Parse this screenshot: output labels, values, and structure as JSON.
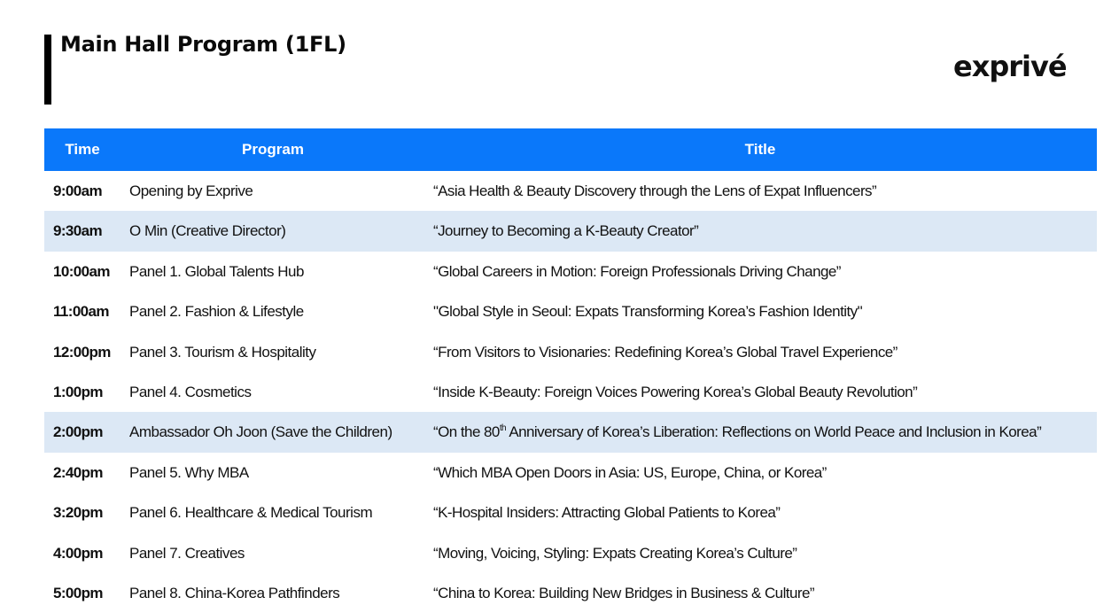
{
  "page": {
    "title": "Main Hall Program (1FL)",
    "logo_text": "exprivé"
  },
  "colors": {
    "header_bg": "#0a78fa",
    "highlight_row_bg": "#dce8f5",
    "title_bar": "#000000"
  },
  "table": {
    "headers": {
      "time": "Time",
      "program": "Program",
      "title": "Title"
    },
    "rows": [
      {
        "time": "9:00am",
        "program": "Opening by Exprive",
        "title": "“Asia Health & Beauty Discovery through the Lens of Expat Influencers”",
        "highlighted": false
      },
      {
        "time": "9:30am",
        "program": "O Min (Creative Director)",
        "title": "“Journey to Becoming a K-Beauty Creator”",
        "highlighted": true
      },
      {
        "time": "10:00am",
        "program": "Panel 1. Global Talents Hub",
        "title": "“Global Careers in Motion: Foreign Professionals Driving Change”",
        "highlighted": false
      },
      {
        "time": "11:00am",
        "program": "Panel 2. Fashion & Lifestyle",
        "title": "\"Global Style in Seoul: Expats Transforming Korea’s Fashion Identity\"",
        "highlighted": false
      },
      {
        "time": "12:00pm",
        "program": "Panel 3. Tourism & Hospitality",
        "title": "“From Visitors to Visionaries: Redefining Korea’s Global Travel Experience”",
        "highlighted": false
      },
      {
        "time": "1:00pm",
        "program": "Panel 4. Cosmetics",
        "title": "“Inside K-Beauty: Foreign Voices Powering Korea’s Global Beauty Revolution”",
        "highlighted": false
      },
      {
        "time": "2:00pm",
        "program": "Ambassador Oh Joon (Save the Children)",
        "title_pre": "“On the 80",
        "title_sup": "th",
        "title_post": " Anniversary of Korea’s Liberation: Reflections on World Peace and Inclusion in Korea”",
        "highlighted": true
      },
      {
        "time": "2:40pm",
        "program": "Panel 5. Why MBA",
        "title": "“Which MBA Open Doors in Asia: US, Europe, China, or Korea”",
        "highlighted": false
      },
      {
        "time": "3:20pm",
        "program": "Panel 6. Healthcare & Medical Tourism",
        "title": "“K-Hospital Insiders: Attracting Global Patients to Korea”",
        "highlighted": false
      },
      {
        "time": "4:00pm",
        "program": "Panel 7. Creatives",
        "title": "“Moving, Voicing, Styling: Expats Creating Korea’s Culture”",
        "highlighted": false
      },
      {
        "time": "5:00pm",
        "program": "Panel 8. China-Korea Pathfinders",
        "title": "“China to Korea: Building New Bridges in Business & Culture”",
        "highlighted": false
      }
    ]
  }
}
